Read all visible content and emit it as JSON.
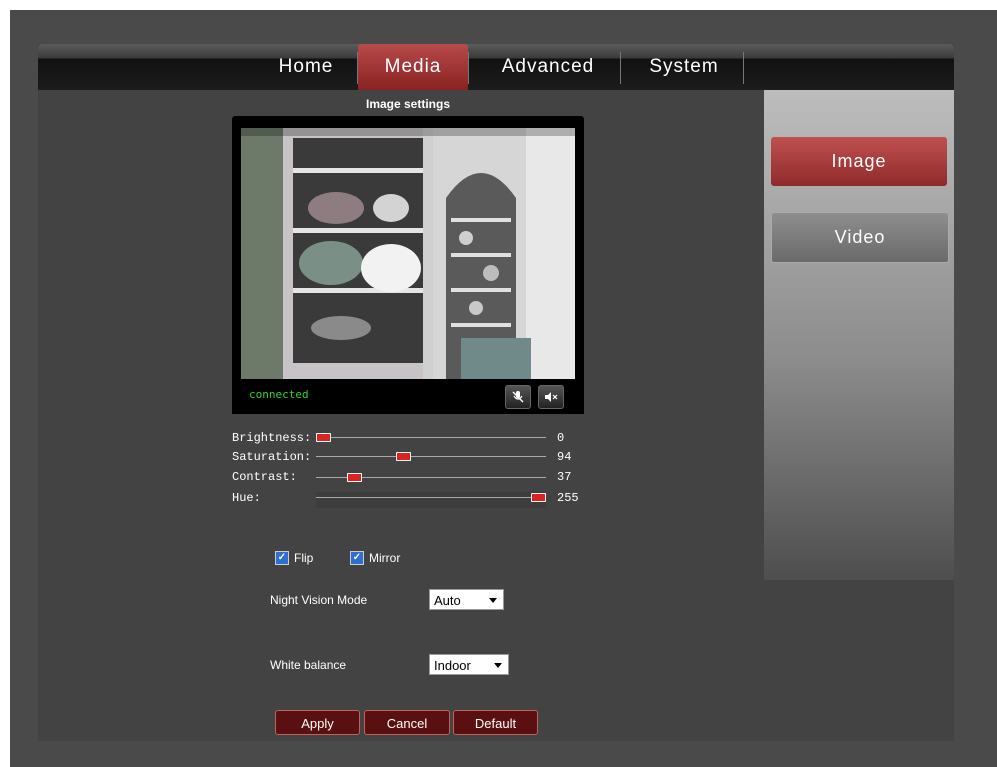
{
  "nav": {
    "tabs": [
      {
        "label": "Home"
      },
      {
        "label": "Media",
        "active": true
      },
      {
        "label": "Advanced"
      },
      {
        "label": "System"
      }
    ]
  },
  "sidebar": {
    "items": [
      {
        "label": "Image",
        "active": true
      },
      {
        "label": "Video"
      }
    ]
  },
  "main": {
    "title": "Image settings",
    "player": {
      "status": "connected",
      "mic_icon": "mic-muted-icon",
      "speaker_icon": "speaker-muted-icon"
    },
    "sliders": [
      {
        "label": "Brightness:",
        "value": "0",
        "level": 0.0
      },
      {
        "label": "Saturation:",
        "value": "94",
        "level": 0.37
      },
      {
        "label": "Contrast:",
        "value": "37",
        "level": 0.145
      },
      {
        "label": "Hue:",
        "value": "255",
        "level": 1.0
      }
    ],
    "flip": {
      "label": "Flip",
      "checked": true
    },
    "mirror": {
      "label": "Mirror",
      "checked": true
    },
    "night_vision": {
      "label": "Night Vision Mode",
      "value": "Auto"
    },
    "white_balance": {
      "label": "White balance",
      "value": "Indoor"
    },
    "buttons": {
      "apply": "Apply",
      "cancel": "Cancel",
      "default": "Default"
    }
  },
  "colors": {
    "accent": "#8a2222",
    "slider_thumb": "#dd2222",
    "status_text": "#2fd32f"
  }
}
